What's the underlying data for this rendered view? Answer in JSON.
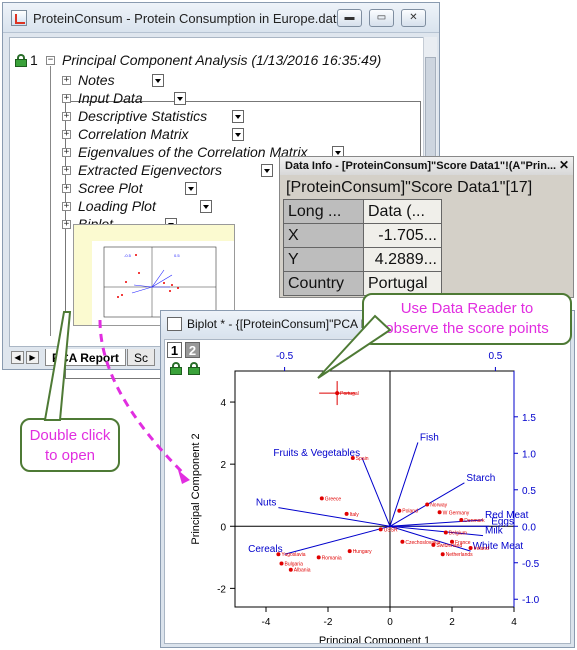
{
  "main_window": {
    "title": "ProteinConsum - Protein Consumption in Europe.dat *",
    "buttons": {
      "minimize": "▬",
      "restore": "▭",
      "close": "✕"
    },
    "tree": {
      "index": "1",
      "root_label": "Principal Component Analysis (1/13/2016 16:35:49)",
      "items": [
        {
          "label": "Notes"
        },
        {
          "label": "Input Data"
        },
        {
          "label": "Descriptive Statistics"
        },
        {
          "label": "Correlation Matrix"
        },
        {
          "label": "Eigenvalues of the Correlation Matrix"
        },
        {
          "label": "Extracted Eigenvectors"
        },
        {
          "label": "Scree Plot"
        },
        {
          "label": "Loading Plot"
        },
        {
          "label": "Biplot"
        }
      ]
    },
    "tabs": {
      "active": "PCA Report",
      "next": "Sc"
    }
  },
  "data_info": {
    "title": "Data Info - [ProteinConsum]\"Score Data1\"!(A\"Prin...",
    "close": "✕",
    "heading": "[ProteinConsum]\"Score Data1\"[17]",
    "header_row": [
      "Long ...",
      "Data (..."
    ],
    "rows": [
      {
        "key": "X",
        "value": "-1.705..."
      },
      {
        "key": "Y",
        "value": "4.2889..."
      },
      {
        "key": "Country",
        "value": "Portugal"
      }
    ]
  },
  "biplot_window": {
    "title": "Biplot * - {[ProteinConsum]\"PCA R",
    "layers": [
      "1",
      "2"
    ]
  },
  "chart_data": {
    "type": "scatter",
    "xlabel": "Principal Component 1",
    "ylabel": "Principal Component 2",
    "xlim": [
      -5,
      4
    ],
    "ylim": [
      -2.6,
      5
    ],
    "x_ticks": [
      "-4",
      "-2",
      "0",
      "2",
      "4"
    ],
    "y_ticks": [
      "-2",
      "0",
      "2",
      "4"
    ],
    "top_ticks": [
      "-0.5",
      "0.5"
    ],
    "right_ticks": [
      "1.5",
      "1.0",
      "0.5",
      "0.0",
      "-0.5",
      "-1.0"
    ],
    "point_color": "#e00000",
    "vector_color": "#0000cc",
    "points": [
      {
        "x": -1.705,
        "y": 4.289,
        "label": "Portugal"
      },
      {
        "x": -1.2,
        "y": 2.2,
        "label": "Spain"
      },
      {
        "x": -2.2,
        "y": 0.9,
        "label": "Greece"
      },
      {
        "x": -1.4,
        "y": 0.4,
        "label": "Italy"
      },
      {
        "x": -0.3,
        "y": -0.1,
        "label": "USSR"
      },
      {
        "x": 0.3,
        "y": 0.5,
        "label": "Poland"
      },
      {
        "x": 1.2,
        "y": 0.7,
        "label": "Norway"
      },
      {
        "x": 1.6,
        "y": 0.45,
        "label": "W Germany"
      },
      {
        "x": 2.3,
        "y": 0.2,
        "label": "Denmark"
      },
      {
        "x": 1.8,
        "y": -0.2,
        "label": "Belgium"
      },
      {
        "x": 2.0,
        "y": -0.5,
        "label": "France"
      },
      {
        "x": 2.6,
        "y": -0.7,
        "label": "Ireland"
      },
      {
        "x": 0.4,
        "y": -0.5,
        "label": "Czechoslovakia"
      },
      {
        "x": 1.4,
        "y": -0.6,
        "label": "Switzerland"
      },
      {
        "x": 1.7,
        "y": -0.9,
        "label": "Netherlands"
      },
      {
        "x": -1.3,
        "y": -0.8,
        "label": "Hungary"
      },
      {
        "x": -2.3,
        "y": -1.0,
        "label": "Romania"
      },
      {
        "x": -3.5,
        "y": -1.2,
        "label": "Bulgaria"
      },
      {
        "x": -3.2,
        "y": -1.4,
        "label": "Albania"
      },
      {
        "x": -3.6,
        "y": -0.9,
        "label": "Yugoslavia"
      }
    ],
    "vectors": [
      {
        "label": "Fish",
        "dx": 0.45,
        "dy": 1.35
      },
      {
        "label": "Fruits & Vegetables",
        "dx": -0.45,
        "dy": 1.1
      },
      {
        "label": "Starch",
        "dx": 1.2,
        "dy": 0.7
      },
      {
        "label": "Nuts",
        "dx": -1.8,
        "dy": 0.3
      },
      {
        "label": "Cereals",
        "dx": -1.7,
        "dy": -0.45
      },
      {
        "label": "Red Meat",
        "dx": 1.5,
        "dy": 0.1
      },
      {
        "label": "Eggs",
        "dx": 1.6,
        "dy": 0.0
      },
      {
        "label": "Milk",
        "dx": 1.5,
        "dy": -0.15
      },
      {
        "label": "White Meat",
        "dx": 1.3,
        "dy": -0.4
      }
    ]
  },
  "callouts": {
    "reader_line1": "Use Data Reader to",
    "reader_line2": "observe the score points",
    "open_line1": "Double click",
    "open_line2": "to open"
  },
  "colors": {
    "callout_text": "#e12ee0",
    "callout_border": "#4e7a35",
    "lock_green": "#3aa23a"
  }
}
